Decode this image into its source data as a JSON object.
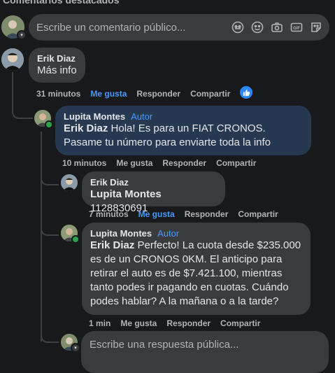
{
  "section_title": "Comentarios destacados",
  "composer": {
    "placeholder": "Escribe un comentario público..."
  },
  "comments": [
    {
      "author": "Erik Diaz",
      "text": "Más info",
      "time": "31 minutos",
      "like": "Me gusta",
      "reply": "Responder",
      "share": "Compartir",
      "liked": true
    },
    {
      "author": "Lupita Montes",
      "badge": "Autor",
      "mention": "Erik Diaz",
      "text": " Hola! Es para un FIAT CRONOS. Pasame tu número para enviarte toda la info",
      "time": "10 minutos",
      "like": "Me gusta",
      "reply": "Responder",
      "share": "Compartir"
    },
    {
      "author": "Erik Diaz",
      "mention": "Lupita Montes",
      "text": " 1128830691",
      "time": "7 minutos",
      "like": "Me gusta",
      "reply": "Responder",
      "share": "Compartir",
      "liked": true
    },
    {
      "author": "Lupita Montes",
      "badge": "Autor",
      "mention": "Erik Diaz",
      "text": " Perfecto! La cuota desde $235.000 es de un CRONOS 0KM. El anticipo para retirar el auto es de $7.421.100, mientras tanto podes ir pagando en cuotas. Cuándo podes hablar? A la mañana o a la tarde?",
      "time": "1 min",
      "like": "Me gusta",
      "reply": "Responder",
      "share": "Compartir"
    }
  ],
  "reply_composer": {
    "placeholder": "Escribe una respuesta pública..."
  },
  "colors": {
    "accent": "#4599ff",
    "bubble": "#3a3b3c",
    "author_bubble": "#263951",
    "background": "#18191a"
  },
  "icons": [
    "avatar-icon",
    "emoji-sticker-icon",
    "smiley-icon",
    "camera-icon",
    "gif-icon",
    "sticker-icon",
    "thumbs-up-icon"
  ]
}
